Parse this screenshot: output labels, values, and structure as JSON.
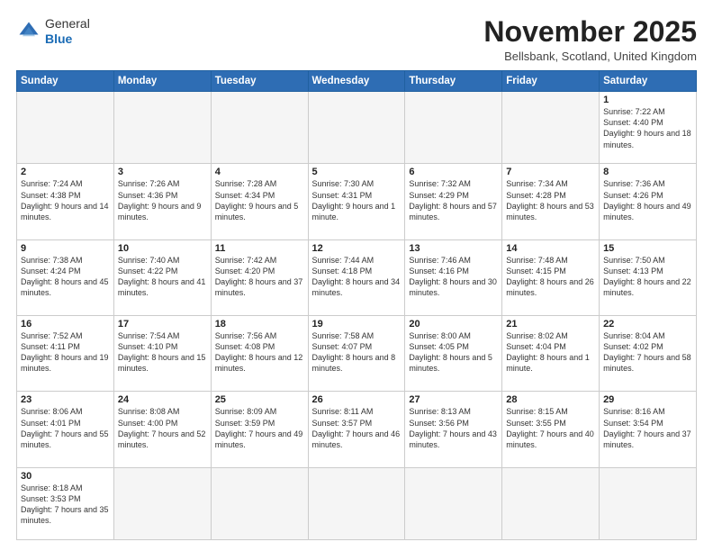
{
  "logo": {
    "line1": "General",
    "line2": "Blue"
  },
  "header": {
    "title": "November 2025",
    "location": "Bellsbank, Scotland, United Kingdom"
  },
  "weekdays": [
    "Sunday",
    "Monday",
    "Tuesday",
    "Wednesday",
    "Thursday",
    "Friday",
    "Saturday"
  ],
  "weeks": [
    [
      {
        "day": "",
        "info": "",
        "empty": true
      },
      {
        "day": "",
        "info": "",
        "empty": true
      },
      {
        "day": "",
        "info": "",
        "empty": true
      },
      {
        "day": "",
        "info": "",
        "empty": true
      },
      {
        "day": "",
        "info": "",
        "empty": true
      },
      {
        "day": "",
        "info": "",
        "empty": true
      },
      {
        "day": "1",
        "info": "Sunrise: 7:22 AM\nSunset: 4:40 PM\nDaylight: 9 hours and 18 minutes."
      }
    ],
    [
      {
        "day": "2",
        "info": "Sunrise: 7:24 AM\nSunset: 4:38 PM\nDaylight: 9 hours and 14 minutes."
      },
      {
        "day": "3",
        "info": "Sunrise: 7:26 AM\nSunset: 4:36 PM\nDaylight: 9 hours and 9 minutes."
      },
      {
        "day": "4",
        "info": "Sunrise: 7:28 AM\nSunset: 4:34 PM\nDaylight: 9 hours and 5 minutes."
      },
      {
        "day": "5",
        "info": "Sunrise: 7:30 AM\nSunset: 4:31 PM\nDaylight: 9 hours and 1 minute."
      },
      {
        "day": "6",
        "info": "Sunrise: 7:32 AM\nSunset: 4:29 PM\nDaylight: 8 hours and 57 minutes."
      },
      {
        "day": "7",
        "info": "Sunrise: 7:34 AM\nSunset: 4:28 PM\nDaylight: 8 hours and 53 minutes."
      },
      {
        "day": "8",
        "info": "Sunrise: 7:36 AM\nSunset: 4:26 PM\nDaylight: 8 hours and 49 minutes."
      }
    ],
    [
      {
        "day": "9",
        "info": "Sunrise: 7:38 AM\nSunset: 4:24 PM\nDaylight: 8 hours and 45 minutes."
      },
      {
        "day": "10",
        "info": "Sunrise: 7:40 AM\nSunset: 4:22 PM\nDaylight: 8 hours and 41 minutes."
      },
      {
        "day": "11",
        "info": "Sunrise: 7:42 AM\nSunset: 4:20 PM\nDaylight: 8 hours and 37 minutes."
      },
      {
        "day": "12",
        "info": "Sunrise: 7:44 AM\nSunset: 4:18 PM\nDaylight: 8 hours and 34 minutes."
      },
      {
        "day": "13",
        "info": "Sunrise: 7:46 AM\nSunset: 4:16 PM\nDaylight: 8 hours and 30 minutes."
      },
      {
        "day": "14",
        "info": "Sunrise: 7:48 AM\nSunset: 4:15 PM\nDaylight: 8 hours and 26 minutes."
      },
      {
        "day": "15",
        "info": "Sunrise: 7:50 AM\nSunset: 4:13 PM\nDaylight: 8 hours and 22 minutes."
      }
    ],
    [
      {
        "day": "16",
        "info": "Sunrise: 7:52 AM\nSunset: 4:11 PM\nDaylight: 8 hours and 19 minutes."
      },
      {
        "day": "17",
        "info": "Sunrise: 7:54 AM\nSunset: 4:10 PM\nDaylight: 8 hours and 15 minutes."
      },
      {
        "day": "18",
        "info": "Sunrise: 7:56 AM\nSunset: 4:08 PM\nDaylight: 8 hours and 12 minutes."
      },
      {
        "day": "19",
        "info": "Sunrise: 7:58 AM\nSunset: 4:07 PM\nDaylight: 8 hours and 8 minutes."
      },
      {
        "day": "20",
        "info": "Sunrise: 8:00 AM\nSunset: 4:05 PM\nDaylight: 8 hours and 5 minutes."
      },
      {
        "day": "21",
        "info": "Sunrise: 8:02 AM\nSunset: 4:04 PM\nDaylight: 8 hours and 1 minute."
      },
      {
        "day": "22",
        "info": "Sunrise: 8:04 AM\nSunset: 4:02 PM\nDaylight: 7 hours and 58 minutes."
      }
    ],
    [
      {
        "day": "23",
        "info": "Sunrise: 8:06 AM\nSunset: 4:01 PM\nDaylight: 7 hours and 55 minutes."
      },
      {
        "day": "24",
        "info": "Sunrise: 8:08 AM\nSunset: 4:00 PM\nDaylight: 7 hours and 52 minutes."
      },
      {
        "day": "25",
        "info": "Sunrise: 8:09 AM\nSunset: 3:59 PM\nDaylight: 7 hours and 49 minutes."
      },
      {
        "day": "26",
        "info": "Sunrise: 8:11 AM\nSunset: 3:57 PM\nDaylight: 7 hours and 46 minutes."
      },
      {
        "day": "27",
        "info": "Sunrise: 8:13 AM\nSunset: 3:56 PM\nDaylight: 7 hours and 43 minutes."
      },
      {
        "day": "28",
        "info": "Sunrise: 8:15 AM\nSunset: 3:55 PM\nDaylight: 7 hours and 40 minutes."
      },
      {
        "day": "29",
        "info": "Sunrise: 8:16 AM\nSunset: 3:54 PM\nDaylight: 7 hours and 37 minutes."
      }
    ],
    [
      {
        "day": "30",
        "info": "Sunrise: 8:18 AM\nSunset: 3:53 PM\nDaylight: 7 hours and 35 minutes."
      },
      {
        "day": "",
        "info": "",
        "empty": true
      },
      {
        "day": "",
        "info": "",
        "empty": true
      },
      {
        "day": "",
        "info": "",
        "empty": true
      },
      {
        "day": "",
        "info": "",
        "empty": true
      },
      {
        "day": "",
        "info": "",
        "empty": true
      },
      {
        "day": "",
        "info": "",
        "empty": true
      }
    ]
  ]
}
